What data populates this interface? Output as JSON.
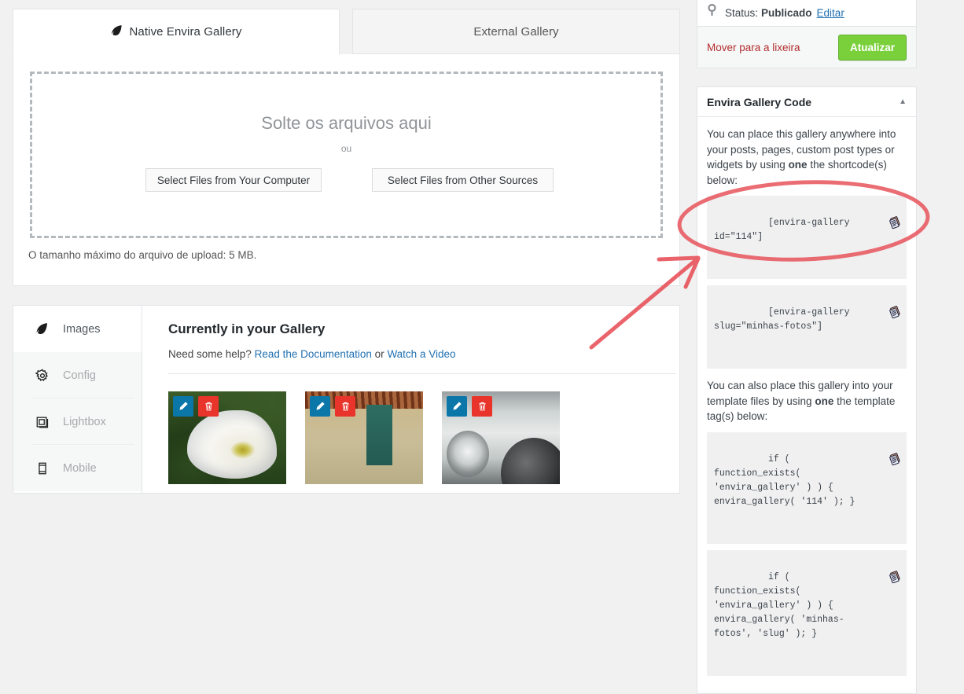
{
  "tabs": [
    {
      "label": "Native Envira Gallery",
      "icon": "envira-leaf-icon",
      "active": true
    },
    {
      "label": "External Gallery",
      "icon": "",
      "active": false
    }
  ],
  "uploader": {
    "drop_title": "Solte os arquivos aqui",
    "or": "ou",
    "btn_computer": "Select Files from Your Computer",
    "btn_other": "Select Files from Other Sources",
    "max_size": "O tamanho máximo do arquivo de upload: 5 MB."
  },
  "gallery": {
    "nav": [
      {
        "label": "Images",
        "icon": "envira-leaf-icon",
        "active": true
      },
      {
        "label": "Config",
        "icon": "gear-icon",
        "active": false
      },
      {
        "label": "Lightbox",
        "icon": "lightbox-icon",
        "active": false
      },
      {
        "label": "Mobile",
        "icon": "mobile-icon",
        "active": false
      }
    ],
    "title": "Currently in your Gallery",
    "help_prefix": "Need some help? ",
    "help_doc": "Read the Documentation",
    "help_or": " or ",
    "help_video": "Watch a Video",
    "thumbnails": [
      {
        "alt": "white calla lily flower",
        "edit_icon": "pencil-icon",
        "delete_icon": "trash-icon"
      },
      {
        "alt": "old building facade with teal door",
        "edit_icon": "pencil-icon",
        "delete_icon": "trash-icon"
      },
      {
        "alt": "vintage white car fender and headlight",
        "edit_icon": "pencil-icon",
        "delete_icon": "trash-icon"
      }
    ]
  },
  "publish": {
    "pin_icon": "pin-icon",
    "status_label": "Status:",
    "status_value": "Publicado",
    "edit_link": "Editar",
    "trash_link": "Mover para a lixeira",
    "update_button": "Atualizar",
    "update_color": "#7ad03a"
  },
  "code_box": {
    "title": "Envira Gallery Code",
    "toggle_icon": "chevron-up-icon",
    "intro_1": "You can place this gallery anywhere into your posts, pages, custom post types or widgets by using ",
    "intro_1_bold": "one",
    "intro_1_end": " the shortcode(s) below:",
    "shortcodes": [
      "[envira-gallery id=\"114\"]",
      "[envira-gallery slug=\"minhas-fotos\"]"
    ],
    "intro_2": "You can also place this gallery into your template files by using ",
    "intro_2_bold": "one",
    "intro_2_end": " the template tag(s) below:",
    "template_tags": [
      "if ( function_exists( 'envira_gallery' ) ) { envira_gallery( '114' ); }",
      "if ( function_exists( 'envira_gallery' ) ) { envira_gallery( 'minhas-fotos', 'slug' ); }"
    ],
    "copy_icon": "copy-clipboard-icon"
  },
  "annotation": {
    "color": "#e8535c",
    "ellipse_label": "highlight-ellipse-around-shortcodes",
    "arrow_label": "pointer-arrow-to-shortcodes"
  }
}
